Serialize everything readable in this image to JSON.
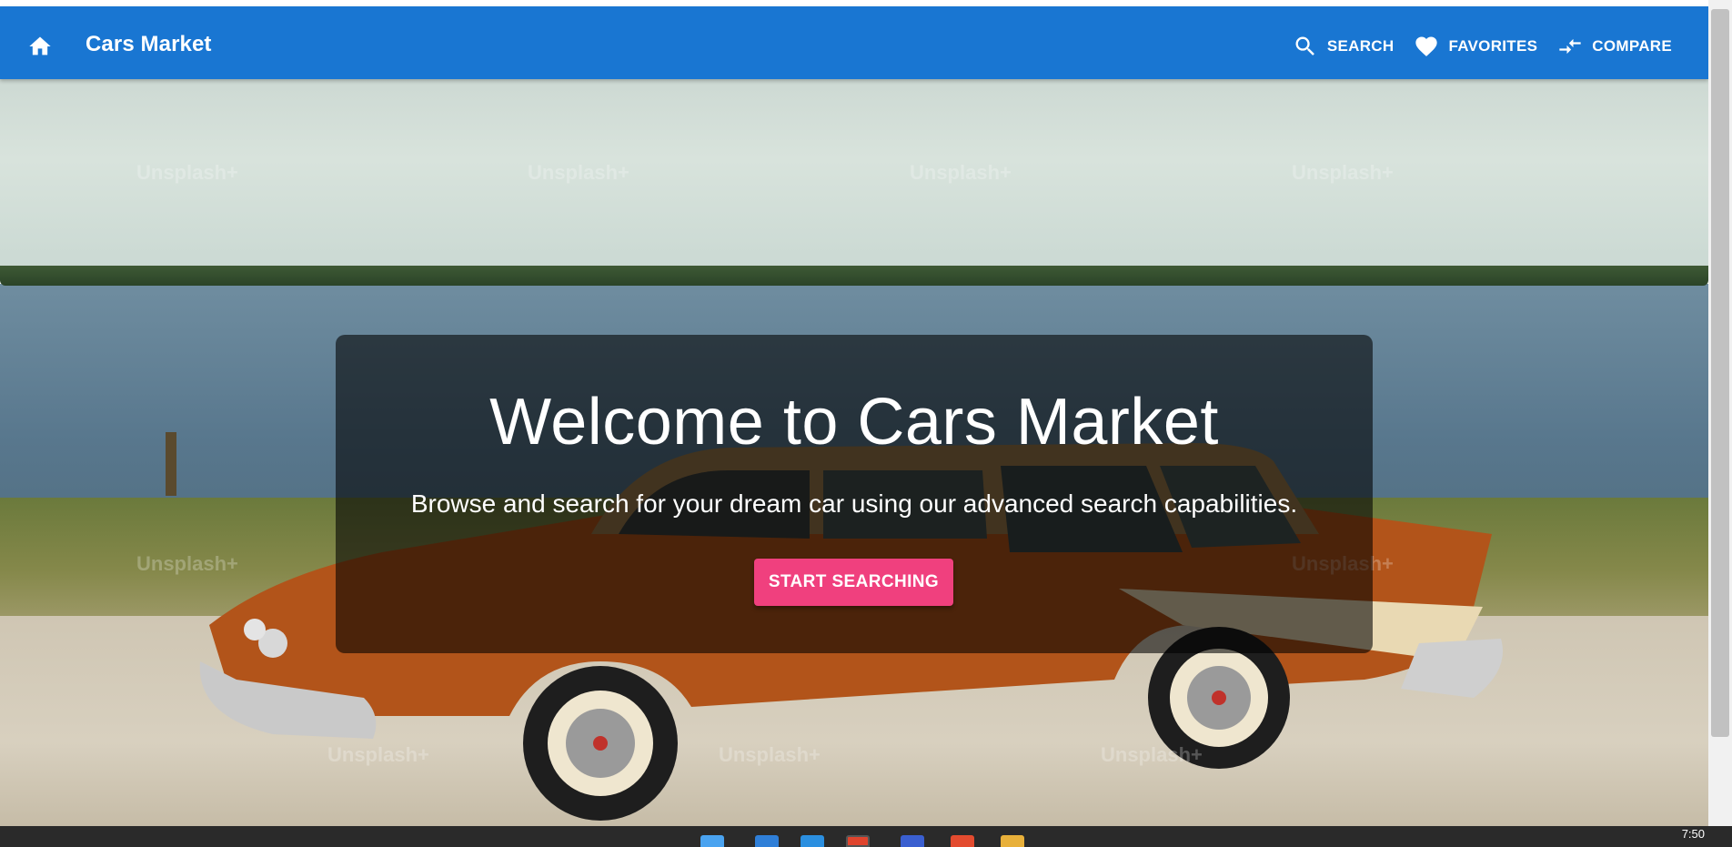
{
  "appbar": {
    "home_icon": "home-icon",
    "brand": "Cars Market",
    "nav": [
      {
        "label": "SEARCH",
        "icon": "search-icon"
      },
      {
        "label": "FAVORITES",
        "icon": "heart-icon"
      },
      {
        "label": "COMPARE",
        "icon": "compare-arrows-icon"
      }
    ],
    "color": "#1976d2"
  },
  "hero": {
    "title": "Welcome to Cars Market",
    "subtitle": "Browse and search for your dream car using our advanced search capabilities.",
    "cta_label": "START SEARCHING",
    "cta_color": "#f0407e",
    "watermark": "Unsplash+"
  },
  "taskbar": {
    "clock": "7:50"
  }
}
